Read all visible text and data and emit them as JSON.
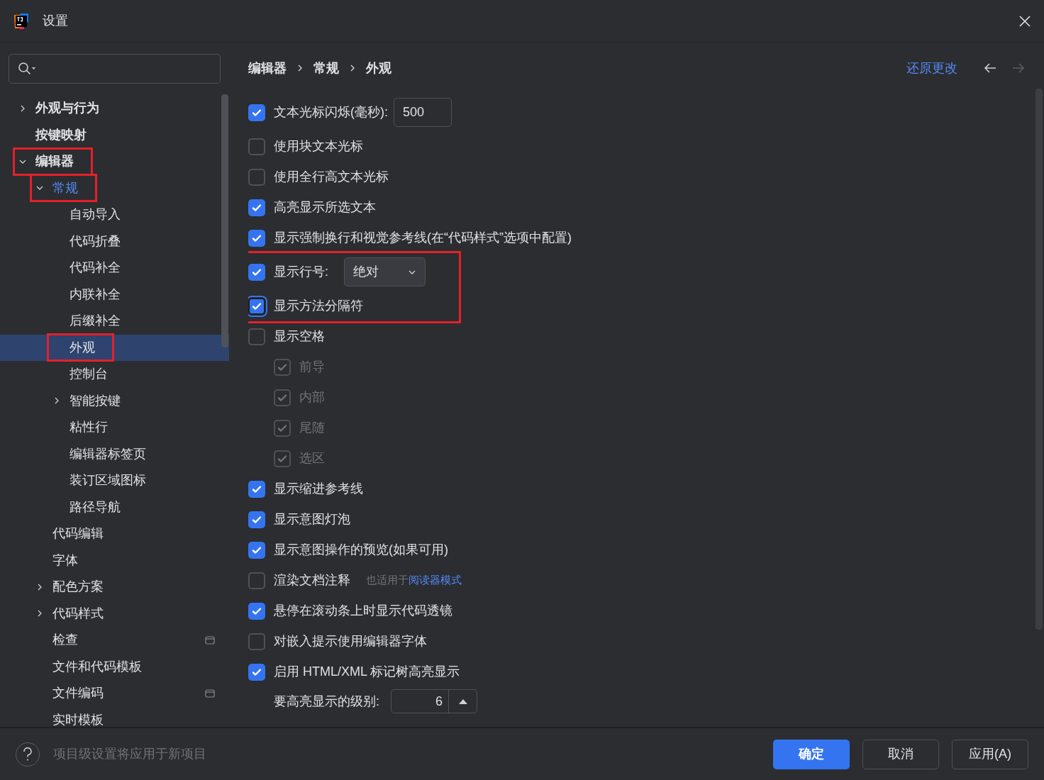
{
  "window": {
    "title": "设置"
  },
  "sidebar": {
    "tree": [
      {
        "label": "外观与行为",
        "expanded": false
      },
      {
        "label": "按键映射"
      },
      {
        "label": "编辑器",
        "expanded": true,
        "annotated": true,
        "children": [
          {
            "label": "常规",
            "expanded": true,
            "modified": true,
            "annotated": true,
            "children": [
              {
                "label": "自动导入",
                "selected": false
              },
              {
                "label": "代码折叠",
                "selected": false
              },
              {
                "label": "代码补全",
                "selected": false
              },
              {
                "label": "内联补全",
                "selected": false
              },
              {
                "label": "后缀补全",
                "selected": false
              },
              {
                "label": "外观",
                "selected": true,
                "annotated": true
              },
              {
                "label": "控制台",
                "selected": false
              },
              {
                "label": "智能按键",
                "expanded": false,
                "selected": false
              },
              {
                "label": "粘性行",
                "selected": false
              },
              {
                "label": "编辑器标签页",
                "selected": false
              },
              {
                "label": "装订区域图标",
                "selected": false
              },
              {
                "label": "路径导航",
                "selected": false
              }
            ]
          },
          {
            "label": "代码编辑"
          },
          {
            "label": "字体"
          },
          {
            "label": "配色方案",
            "expanded": false
          },
          {
            "label": "代码样式",
            "expanded": false
          },
          {
            "label": "检查",
            "project_scope": true
          },
          {
            "label": "文件和代码模板"
          },
          {
            "label": "文件编码",
            "project_scope": true
          },
          {
            "label": "实时模板"
          }
        ]
      }
    ]
  },
  "breadcrumb": [
    "编辑器",
    "常规",
    "外观"
  ],
  "header": {
    "reset_link": "还原更改",
    "back_enabled": true,
    "forward_enabled": false
  },
  "settings": [
    {
      "kind": "checkbox_input",
      "label": "文本光标闪烁(毫秒):",
      "checked": true,
      "value": "500"
    },
    {
      "kind": "checkbox",
      "label": "使用块文本光标",
      "checked": false
    },
    {
      "kind": "checkbox",
      "label": "使用全行高文本光标",
      "checked": false
    },
    {
      "kind": "checkbox",
      "label": "高亮显示所选文本",
      "checked": true
    },
    {
      "kind": "checkbox",
      "label": "显示强制换行和视觉参考线(在“代码样式”选项中配置)",
      "checked": true
    },
    {
      "kind": "checkbox_select",
      "label": "显示行号:",
      "checked": true,
      "value": "绝对",
      "annotated": true
    },
    {
      "kind": "checkbox",
      "label": "显示方法分隔符",
      "checked": true,
      "focused": true,
      "annotated": true
    },
    {
      "kind": "checkbox",
      "label": "显示空格",
      "checked": false,
      "children": [
        {
          "label": "前导",
          "checked": true,
          "disabled": true
        },
        {
          "label": "内部",
          "checked": true,
          "disabled": true
        },
        {
          "label": "尾随",
          "checked": true,
          "disabled": true
        },
        {
          "label": "选区",
          "checked": true,
          "disabled": true
        }
      ]
    },
    {
      "kind": "checkbox",
      "label": "显示缩进参考线",
      "checked": true
    },
    {
      "kind": "checkbox",
      "label": "显示意图灯泡",
      "checked": true
    },
    {
      "kind": "checkbox",
      "label": "显示意图操作的预览(如果可用)",
      "checked": true
    },
    {
      "kind": "checkbox_hint",
      "label": "渲染文档注释",
      "checked": false,
      "hint": "也适用于",
      "link": "阅读器模式"
    },
    {
      "kind": "checkbox",
      "label": "悬停在滚动条上时显示代码透镜",
      "checked": true
    },
    {
      "kind": "checkbox",
      "label": "对嵌入提示使用编辑器字体",
      "checked": false
    },
    {
      "kind": "checkbox",
      "label": "启用 HTML/XML 标记树高亮显示",
      "checked": true
    },
    {
      "kind": "spinner",
      "label": "要高亮显示的级别:",
      "value": "6"
    }
  ],
  "footer": {
    "help_hint": "项目级设置将应用于新项目",
    "buttons": [
      {
        "label": "确定",
        "primary": true
      },
      {
        "label": "取消",
        "primary": false
      },
      {
        "label": "应用(A)",
        "primary": false
      }
    ]
  }
}
